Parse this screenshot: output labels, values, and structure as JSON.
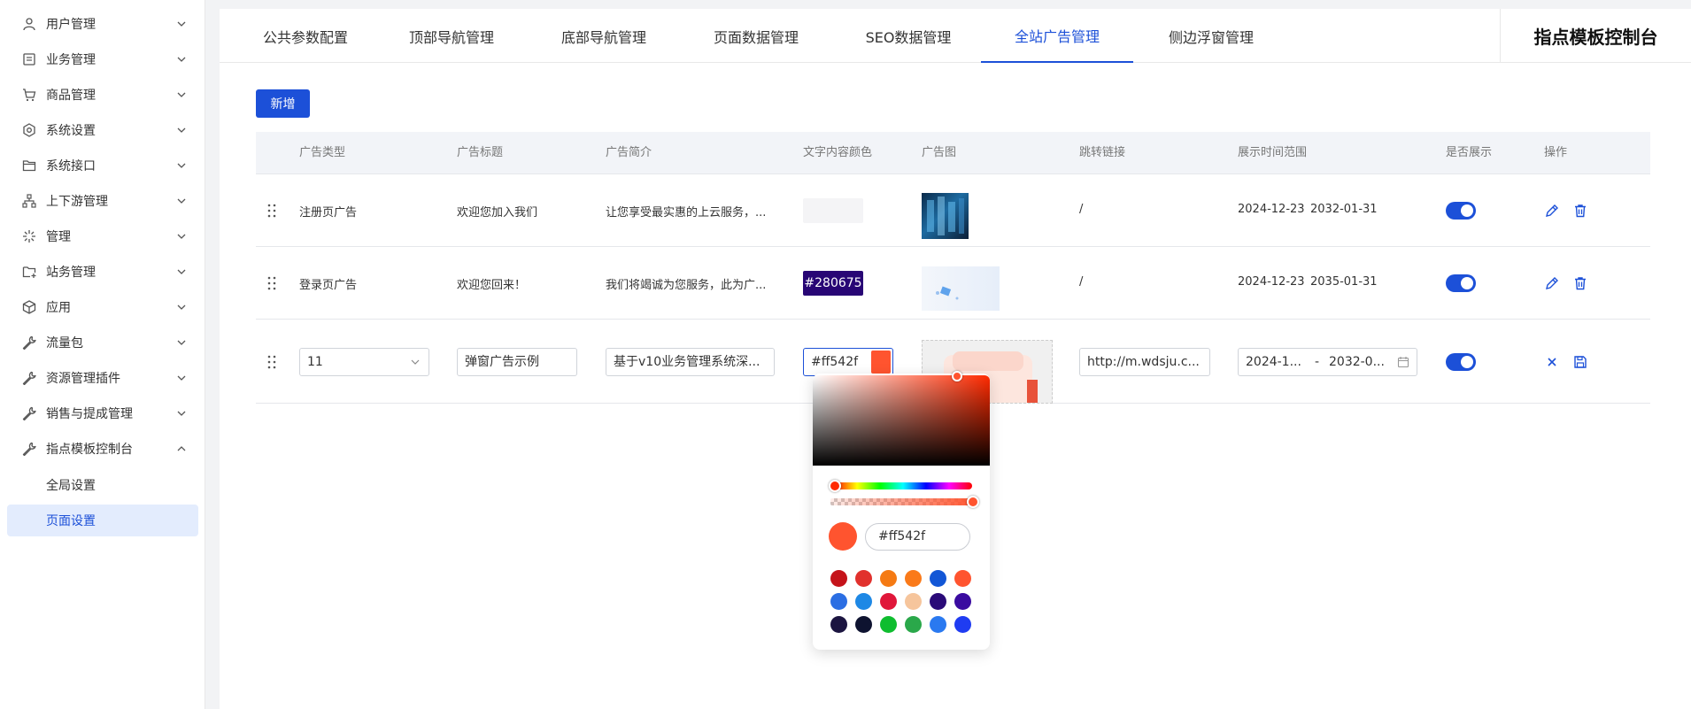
{
  "sidebar": {
    "items": [
      {
        "label": "用户管理",
        "icon": "user-icon"
      },
      {
        "label": "业务管理",
        "icon": "list-icon"
      },
      {
        "label": "商品管理",
        "icon": "cart-icon"
      },
      {
        "label": "系统设置",
        "icon": "settings-icon"
      },
      {
        "label": "系统接口",
        "icon": "folder-icon"
      },
      {
        "label": "上下游管理",
        "icon": "hierarchy-icon"
      },
      {
        "label": "管理",
        "icon": "sparkle-icon"
      },
      {
        "label": "站务管理",
        "icon": "folder-add-icon"
      },
      {
        "label": "应用",
        "icon": "cube-icon"
      },
      {
        "label": "流量包",
        "icon": "wrench-icon"
      },
      {
        "label": "资源管理插件",
        "icon": "wrench-icon"
      },
      {
        "label": "销售与提成管理",
        "icon": "wrench-icon"
      },
      {
        "label": "指点模板控制台",
        "icon": "wrench-icon"
      }
    ],
    "sub_items": [
      {
        "label": "全局设置"
      },
      {
        "label": "页面设置"
      }
    ]
  },
  "tabs": [
    {
      "label": "公共参数配置"
    },
    {
      "label": "顶部导航管理"
    },
    {
      "label": "底部导航管理"
    },
    {
      "label": "页面数据管理"
    },
    {
      "label": "SEO数据管理"
    },
    {
      "label": "全站广告管理"
    },
    {
      "label": "侧边浮窗管理"
    }
  ],
  "page_title": "指点模板控制台",
  "add_button": "新增",
  "table": {
    "headers": [
      "广告类型",
      "广告标题",
      "广告简介",
      "文字内容颜色",
      "广告图",
      "跳转链接",
      "展示时间范围",
      "是否展示",
      "操作"
    ],
    "rows": [
      {
        "type": "注册页广告",
        "title": "欢迎您加入我们",
        "intro": "让您享受最实惠的上云服务，...",
        "color": "",
        "link": "/",
        "time_start": "2024-12-23",
        "time_end": "2032-01-31"
      },
      {
        "type": "登录页广告",
        "title": "欢迎您回来！",
        "intro": "我们将竭诚为您服务，此为广...",
        "color": "#280675",
        "link": "/",
        "time_start": "2024-12-23",
        "time_end": "2035-01-31"
      }
    ],
    "edit_row": {
      "type": "11",
      "title": "弹窗广告示例",
      "intro": "基于v10业务管理系统深...",
      "color": "#ff542f",
      "link": "http://m.wdsju.c...",
      "time_start": "2024-1...",
      "time_sep": "-",
      "time_end": "2032-0..."
    }
  },
  "color_picker": {
    "value": "#ff542f",
    "swatches": [
      "#c5131a",
      "#e1312d",
      "#f57a13",
      "#fa7a1a",
      "#1256d6",
      "#ff542f",
      "#2b6ee3",
      "#1e88e5",
      "#e0173a",
      "#f6c59c",
      "#2a0a78",
      "#3a0ba0",
      "#1b1440",
      "#0e1330",
      "#0fbd2f",
      "#2aa84a",
      "#2a79f0",
      "#1f3cf2"
    ]
  },
  "colors": {
    "accent": "#1c50d8",
    "dark_swatch": "#280675"
  }
}
